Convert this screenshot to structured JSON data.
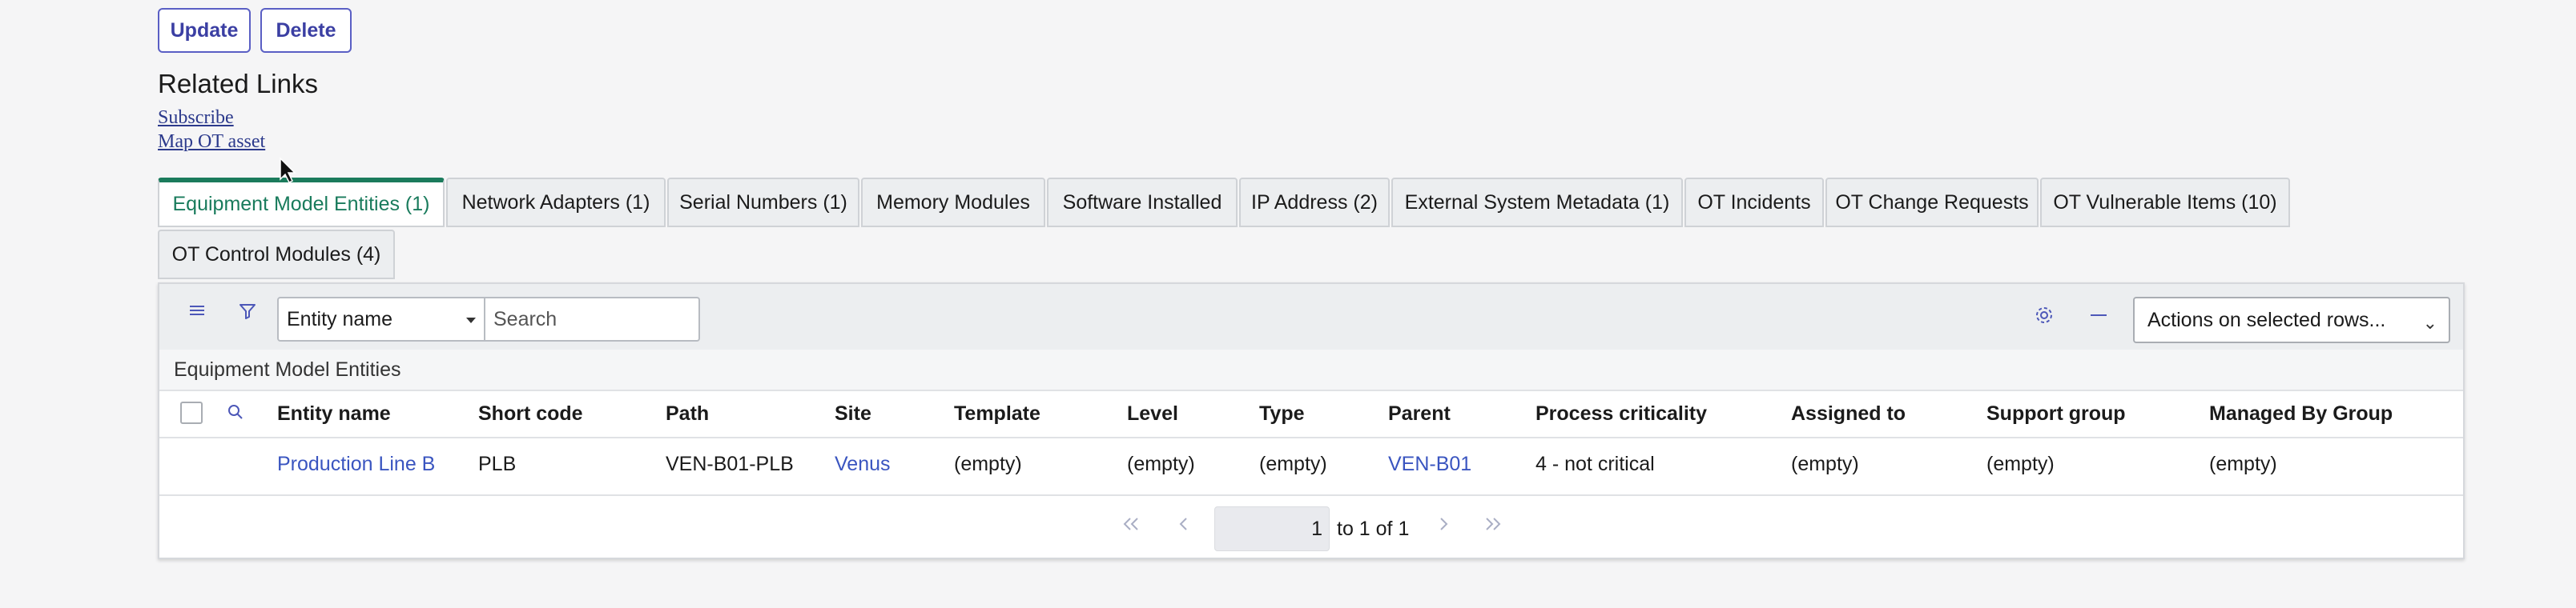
{
  "buttons": {
    "update": "Update",
    "delete": "Delete"
  },
  "related_links": {
    "title": "Related Links",
    "items": [
      "Subscribe",
      "Map OT asset"
    ]
  },
  "tabs": [
    "Equipment Model Entities (1)",
    "Network Adapters (1)",
    "Serial Numbers (1)",
    "Memory Modules",
    "Software Installed",
    "IP Address (2)",
    "External System Metadata (1)",
    "OT Incidents",
    "OT Change Requests",
    "OT Vulnerable Items (10)",
    "OT Control Modules (4)"
  ],
  "active_tab": "Equipment Model Entities (1)",
  "list": {
    "filter_field": "Entity name",
    "search_placeholder": "Search",
    "actions_select": "Actions on selected rows...",
    "title": "Equipment Model Entities",
    "columns": [
      "Entity name",
      "Short code",
      "Path",
      "Site",
      "Template",
      "Level",
      "Type",
      "Parent",
      "Process criticality",
      "Assigned to",
      "Support group",
      "Managed By Group"
    ],
    "rows": [
      [
        "Production Line B",
        "PLB",
        "VEN-B01-PLB",
        "Venus",
        "(empty)",
        "(empty)",
        "(empty)",
        "VEN-B01",
        "4 - not critical",
        "(empty)",
        "(empty)",
        "(empty)"
      ]
    ],
    "pagination": {
      "current": "1",
      "summary": "to 1 of 1"
    }
  },
  "colors": {
    "accent": "#197b5c",
    "link": "#3a55c0",
    "button_border": "#5a5fc4"
  },
  "icons": [
    "list-menu-icon",
    "filter-icon",
    "search-icon",
    "gear-icon",
    "minus-icon",
    "first-page-icon",
    "prev-page-icon",
    "next-page-icon",
    "last-page-icon",
    "cursor-icon"
  ]
}
